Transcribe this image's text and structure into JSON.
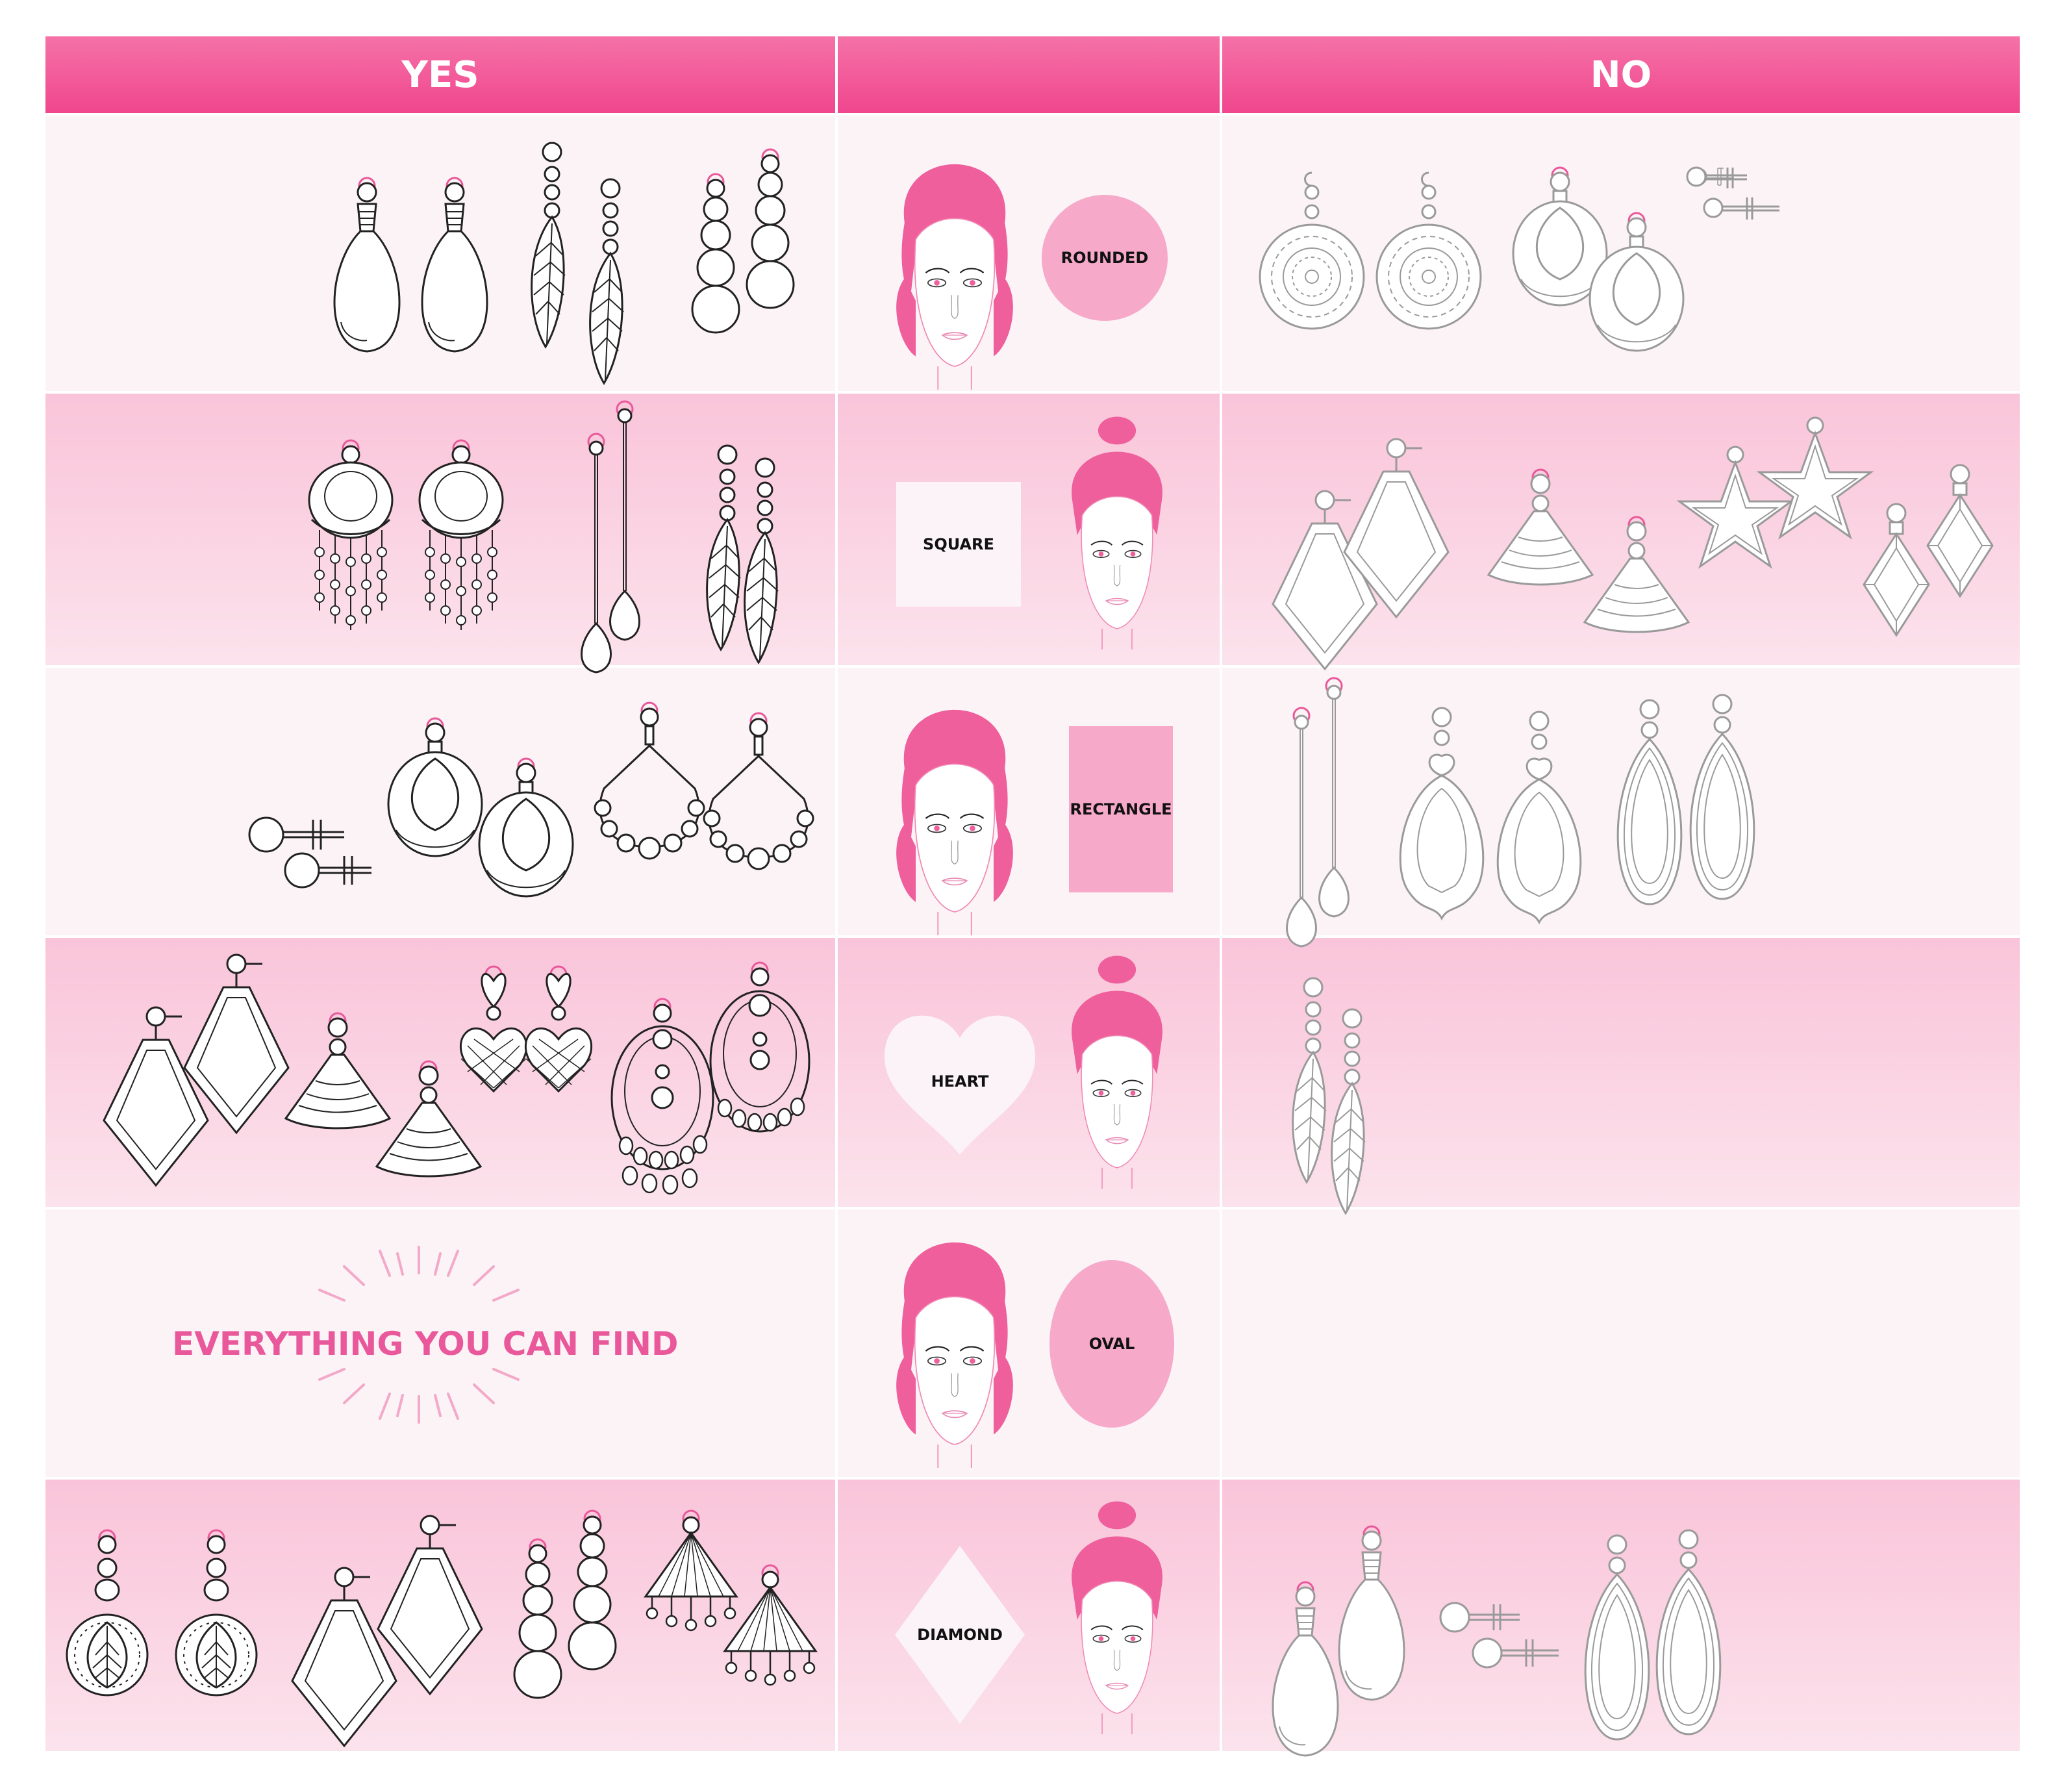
{
  "header": {
    "yes_label": "YES",
    "middle_label": "",
    "no_label": "NO"
  },
  "colors": {
    "accent": "#f0468d",
    "pink_light": "#f9c4d9",
    "row_light": "#fcf3f6",
    "shape_pink": "#f6a9c9",
    "line_dark": "#222222",
    "line_gray": "#9a9a9a"
  },
  "rows": [
    {
      "shape": "ROUNDED",
      "shape_form": "circle"
    },
    {
      "shape": "SQUARE",
      "shape_form": "square"
    },
    {
      "shape": "RECTANGLE",
      "shape_form": "rectangle"
    },
    {
      "shape": "HEART",
      "shape_form": "heart"
    },
    {
      "shape": "OVAL",
      "shape_form": "oval"
    },
    {
      "shape": "DIAMOND",
      "shape_form": "diamond"
    }
  ],
  "slogan": "EVERYTHING YOU CAN FIND"
}
